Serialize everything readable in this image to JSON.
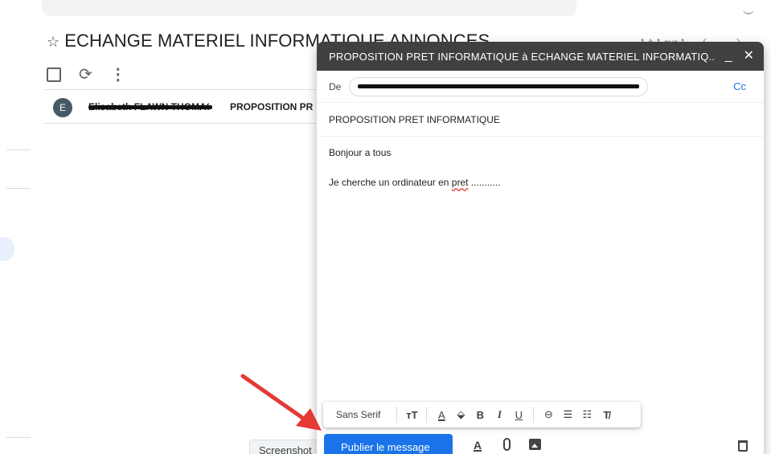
{
  "group": {
    "title": "ECHANGE MATERIEL INFORMATIQUE ANNONCES",
    "star_icon": "star-outline-icon",
    "pager": "1 à 1 sur 1",
    "thread": {
      "avatar_letter": "E",
      "sender": "Elisabeth FLAWN THOMAS",
      "subject": "PROPOSITION PR"
    }
  },
  "compose": {
    "title": "PROPOSITION PRET INFORMATIQUE à ECHANGE MATERIEL INFORMATIQ...",
    "minimize": "_",
    "close": "✕",
    "from_label": "De",
    "cc_label": "Cc",
    "subject": "PROPOSITION PRET INFORMATIQUE",
    "body_line1": "Bonjour a tous",
    "body_line2_before": "Je cherche un ordinateur en ",
    "body_line2_misspelled": "pret",
    "body_line2_after": " ..........."
  },
  "format_bar": {
    "font": "Sans Serif",
    "size_icon": "text-size-icon",
    "color_icon": "text-color-icon",
    "highlight_icon": "highlight-icon",
    "bold": "B",
    "italic": "I",
    "underline": "U",
    "link_icon": "link-icon",
    "numbered_icon": "numbered-list-icon",
    "bullet_icon": "bulleted-list-icon",
    "clear_icon": "clear-format-icon"
  },
  "actions": {
    "publish": "Publier le message",
    "format_toggle_icon": "format-options-icon",
    "attach_icon": "attach-icon",
    "image_icon": "insert-photo-icon",
    "trash_icon": "trash-icon"
  },
  "screenshot_tooltip": "Screenshot",
  "accent_color": "#1a73e8",
  "header_color": "#404040",
  "arrow_color": "#e53935"
}
